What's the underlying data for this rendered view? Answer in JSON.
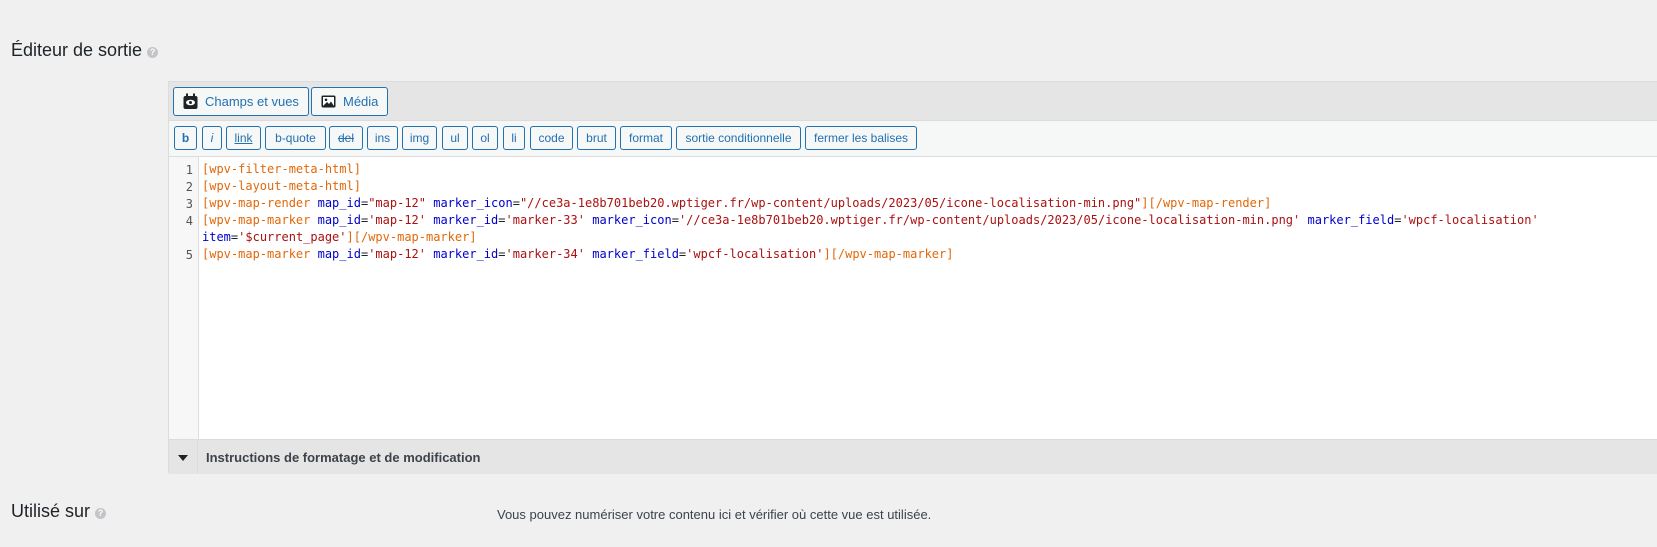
{
  "section": {
    "title": "Éditeur de sortie",
    "help": "?"
  },
  "toolbar": {
    "fields_views_label": "Champs et vues",
    "media_label": "Média"
  },
  "quicktags": [
    "b",
    "i",
    "link",
    "b-quote",
    "del",
    "ins",
    "img",
    "ul",
    "ol",
    "li",
    "code",
    "brut",
    "format",
    "sortie conditionnelle",
    "fermer les balises"
  ],
  "code": {
    "line_numbers": [
      "1",
      "2",
      "3",
      "4",
      "5"
    ],
    "line1": "[wpv-filter-meta-html]",
    "line2": "[wpv-layout-meta-html]",
    "line3": {
      "open": "[wpv-map-render",
      "attr1": "map_id",
      "val1": "\"map-12\"",
      "attr2": "marker_icon",
      "val2": "\"//ce3a-1e8b701beb20.wptiger.fr/wp-content/uploads/2023/05/icone-localisation-min.png\"",
      "close": "][/wpv-map-render]"
    },
    "line4": {
      "open": "[wpv-map-marker",
      "attr1": "map_id",
      "val1": "'map-12'",
      "attr2": "marker_id",
      "val2": "'marker-33'",
      "attr3": "marker_icon",
      "val3": "'//ce3a-1e8b701beb20.wptiger.fr/wp-content/uploads/2023/05/icone-localisation-min.png'",
      "attr4": "marker_field",
      "val4": "'wpcf-localisation'",
      "attr5": "item",
      "val5": "'$current_page'",
      "close": "][/wpv-map-marker]"
    },
    "line5": {
      "open": "[wpv-map-marker",
      "attr1": "map_id",
      "val1": "'map-12'",
      "attr2": "marker_id",
      "val2": "'marker-34'",
      "attr3": "marker_field",
      "val3": "'wpcf-localisation'",
      "close": "][/wpv-map-marker]"
    }
  },
  "instructions": {
    "label": "Instructions de formatage et de modification"
  },
  "used_on": {
    "title": "Utilisé sur",
    "description": "Vous pouvez numériser votre contenu ici et vérifier où cette vue est utilisée."
  }
}
